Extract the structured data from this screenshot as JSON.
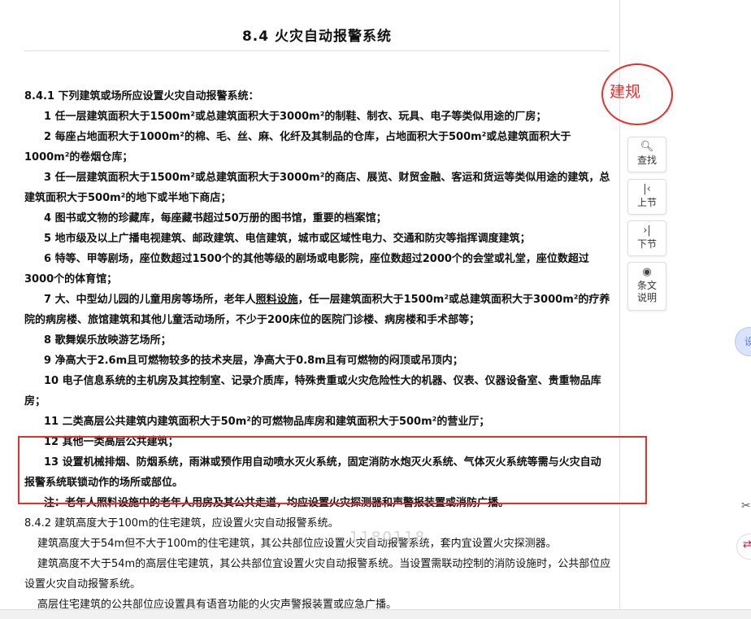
{
  "document": {
    "title": "8.4  火灾自动报警系统",
    "clause_841": {
      "intro": "8.4.1  下列建筑或场所应设置火灾自动报警系统：",
      "items": [
        "1  任一层建筑面积大于1500m²或总建筑面积大于3000m²的制鞋、制衣、玩具、电子等类似用途的厂房；",
        "2  每座占地面积大于1000m²的棉、毛、丝、麻、化纤及其制品的仓库，占地面积大于500m²或总建筑面积大于1000m²的卷烟仓库；",
        "3  任一层建筑面积大于1500m²或总建筑面积大于3000m²的商店、展览、财贸金融、客运和货运等类似用途的建筑，总建筑面积大于500m²的地下或半地下商店；",
        "4  图书或文物的珍藏库，每座藏书超过50万册的图书馆，重要的档案馆；",
        "5  地市级及以上广播电视建筑、邮政建筑、电信建筑，城市或区域性电力、交通和防灾等指挥调度建筑；",
        "6  特等、甲等剧场，座位数超过1500个的其他等级的剧场或电影院，座位数超过2000个的会堂或礼堂，座位数超过3000个的体育馆；"
      ],
      "item7_a": "7  大、中型幼儿园的儿童用房等场所，老年人",
      "item7_link": "照料设施",
      "item7_b": "，任一层建筑面积大于1500m²或总建筑面积大于3000m²的疗养院的病房楼、旅馆建筑和其他儿童活动场所，不少于200床位的医院门诊楼、病房楼和手术部等；",
      "items_b": [
        "8  歌舞娱乐放映游艺场所；",
        "9  净高大于2.6m且可燃物较多的技术夹层，净高大于0.8m且有可燃物的闷顶或吊顶内；",
        "10  电子信息系统的主机房及其控制室、记录介质库，特殊贵重或火灾危险性大的机器、仪表、仪器设备室、贵重物品库房；",
        "11  二类高层公共建筑内建筑面积大于50m²的可燃物品库房和建筑面积大于500m²的营业厅；",
        "12  其他一类高层公共建筑；",
        "13  设置机械排烟、防烟系统，雨淋或预作用自动喷水灭火系统，固定消防水炮灭火系统、气体灭火系统等需与火灾自动报警系统联锁动作的场所或部位。"
      ],
      "note": "注：老年人照料设施中的老年人用房及其公共走道，均应设置火灾探测器和声警报装置或消防广播。"
    },
    "clause_842": {
      "intro": "8.4.2  建筑高度大于100m的住宅建筑，应设置火灾自动报警系统。",
      "paras": [
        "建筑高度大于54m但不大于100m的住宅建筑，其公共部位应设置火灾自动报警系统，套内宜设置火灾探测器。",
        "建筑高度不大于54m的高层住宅建筑，其公共部位宜设置火灾自动报警系统。当设置需联动控制的消防设施时，公共部位应设置火灾自动报警系统。",
        "高层住宅建筑的公共部位应设置具有语音功能的火灾声警报装置或应急广播。"
      ]
    }
  },
  "stamp": {
    "text": "建规",
    "color": "#e0312f"
  },
  "watermark": "1180118",
  "toolbar": {
    "search": "查找",
    "prev_section": "上节",
    "next_section": "下节",
    "explanation": "条文说明"
  },
  "highlight_color": "#e0312f",
  "edge": {
    "partial_label": "设"
  }
}
